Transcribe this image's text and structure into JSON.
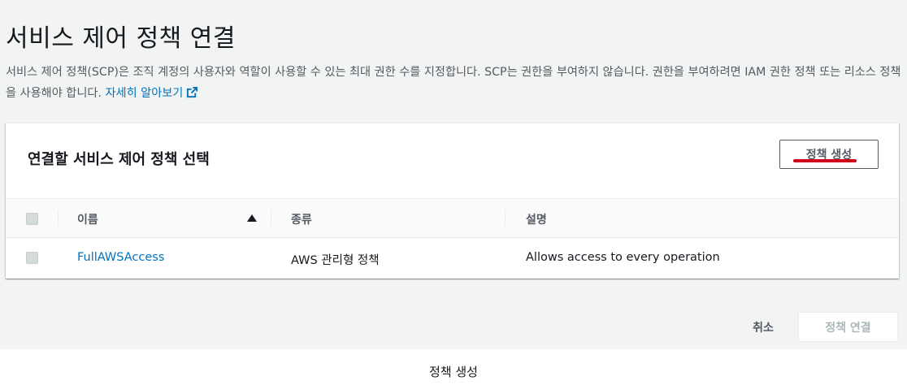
{
  "page": {
    "title": "서비스 제어 정책 연결",
    "description": "서비스 제어 정책(SCP)은 조직 계정의 사용자와 역할이 사용할 수 있는 최대 권한 수를 지정합니다. SCP는 권한을 부여하지 않습니다. 권한을 부여하려면 IAM 권한 정책 또는 리소스 정책을 사용해야 합니다.",
    "learn_more_link": "자세히 알아보기",
    "link_icon": "external-link-icon",
    "link_color": "#0073bb"
  },
  "panel": {
    "title": "연결할 서비스 제어 정책 선택",
    "create_button": "정책 생성",
    "highlight_color": "#d0021b"
  },
  "table": {
    "headers": [
      "이름",
      "종류",
      "설명"
    ],
    "sort_icon": "sort-ascending-icon",
    "rows": [
      {
        "name": "FullAWSAccess",
        "type": "AWS 관리형 정책",
        "description": "Allows access to every operation",
        "selected": false
      }
    ]
  },
  "footer": {
    "cancel_button": "취소",
    "attach_button": "정책 연결",
    "attach_disabled": true
  },
  "caption": "정책 생성"
}
